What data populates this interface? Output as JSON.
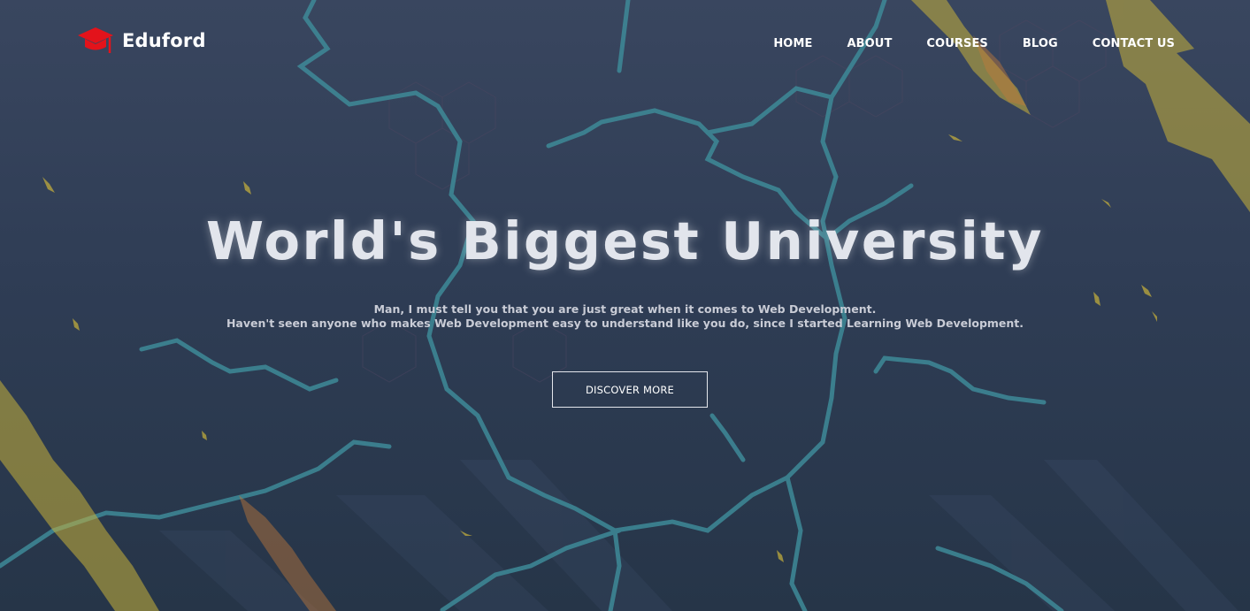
{
  "brand": {
    "name": "Eduford",
    "icon": "graduation-cap-icon",
    "icon_color": "#e3131b"
  },
  "nav": {
    "items": [
      {
        "label": "HOME"
      },
      {
        "label": "ABOUT"
      },
      {
        "label": "COURSES"
      },
      {
        "label": "BLOG"
      },
      {
        "label": "CONTACT US"
      }
    ]
  },
  "hero": {
    "title": "World's Biggest University",
    "subtitle_line1": "Man, I must tell you that you are just great when it comes to Web Development.",
    "subtitle_line2": "Haven't seen anyone who makes Web Development easy to understand like you do, since I started Learning Web Development.",
    "cta_label": "DISCOVER MORE"
  },
  "colors": {
    "background": "#2f3d55",
    "lightning_teal": "#3e8a98",
    "lightning_yellow": "#c9b23a",
    "text": "#ffffff"
  }
}
